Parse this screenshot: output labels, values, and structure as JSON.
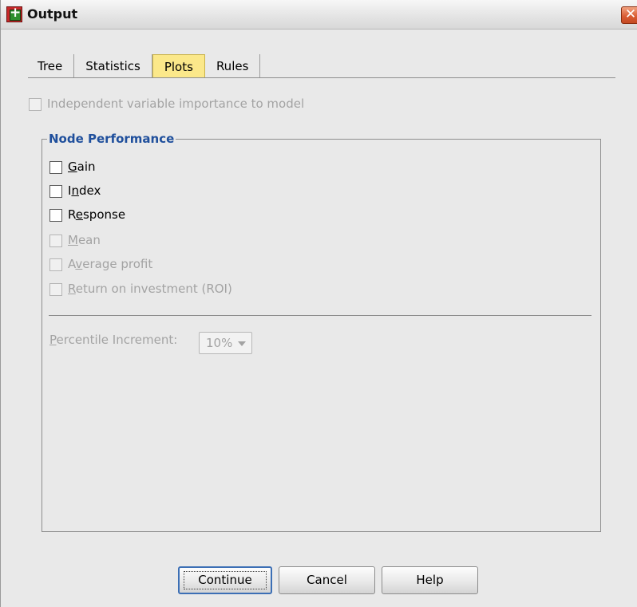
{
  "window": {
    "title": "Output",
    "close_symbol": "✕"
  },
  "tabs": [
    {
      "label": "Tree",
      "active": false
    },
    {
      "label": "Statistics",
      "active": false
    },
    {
      "label": "Plots",
      "active": true
    },
    {
      "label": "Rules",
      "active": false
    }
  ],
  "importance": {
    "label": "Independent variable importance to model",
    "checked": false,
    "enabled": false
  },
  "node_performance": {
    "title": "Node Performance",
    "options": [
      {
        "mnemonic": "G",
        "rest": "ain",
        "prefix": "",
        "checked": false,
        "enabled": true
      },
      {
        "mnemonic": "n",
        "rest": "dex",
        "prefix": "I",
        "checked": false,
        "enabled": true
      },
      {
        "mnemonic": "e",
        "rest": "sponse",
        "prefix": "R",
        "checked": false,
        "enabled": true
      },
      {
        "mnemonic": "M",
        "rest": "ean",
        "prefix": "",
        "checked": false,
        "enabled": false
      },
      {
        "mnemonic": "v",
        "rest": "erage profit",
        "prefix": "A",
        "checked": false,
        "enabled": false
      },
      {
        "mnemonic": "R",
        "rest": "eturn on investment (ROI)",
        "prefix": "",
        "checked": false,
        "enabled": false
      }
    ],
    "percentile": {
      "label_mnemonic": "P",
      "label_rest": "ercentile Increment:",
      "value": "10%",
      "enabled": false
    }
  },
  "buttons": {
    "continue": "Continue",
    "cancel": "Cancel",
    "help": "Help"
  },
  "colors": {
    "active_tab": "#fbe88a",
    "group_title": "#1f4f9c",
    "close_button": "#d85a31",
    "default_button_border": "#3c6fb5"
  }
}
